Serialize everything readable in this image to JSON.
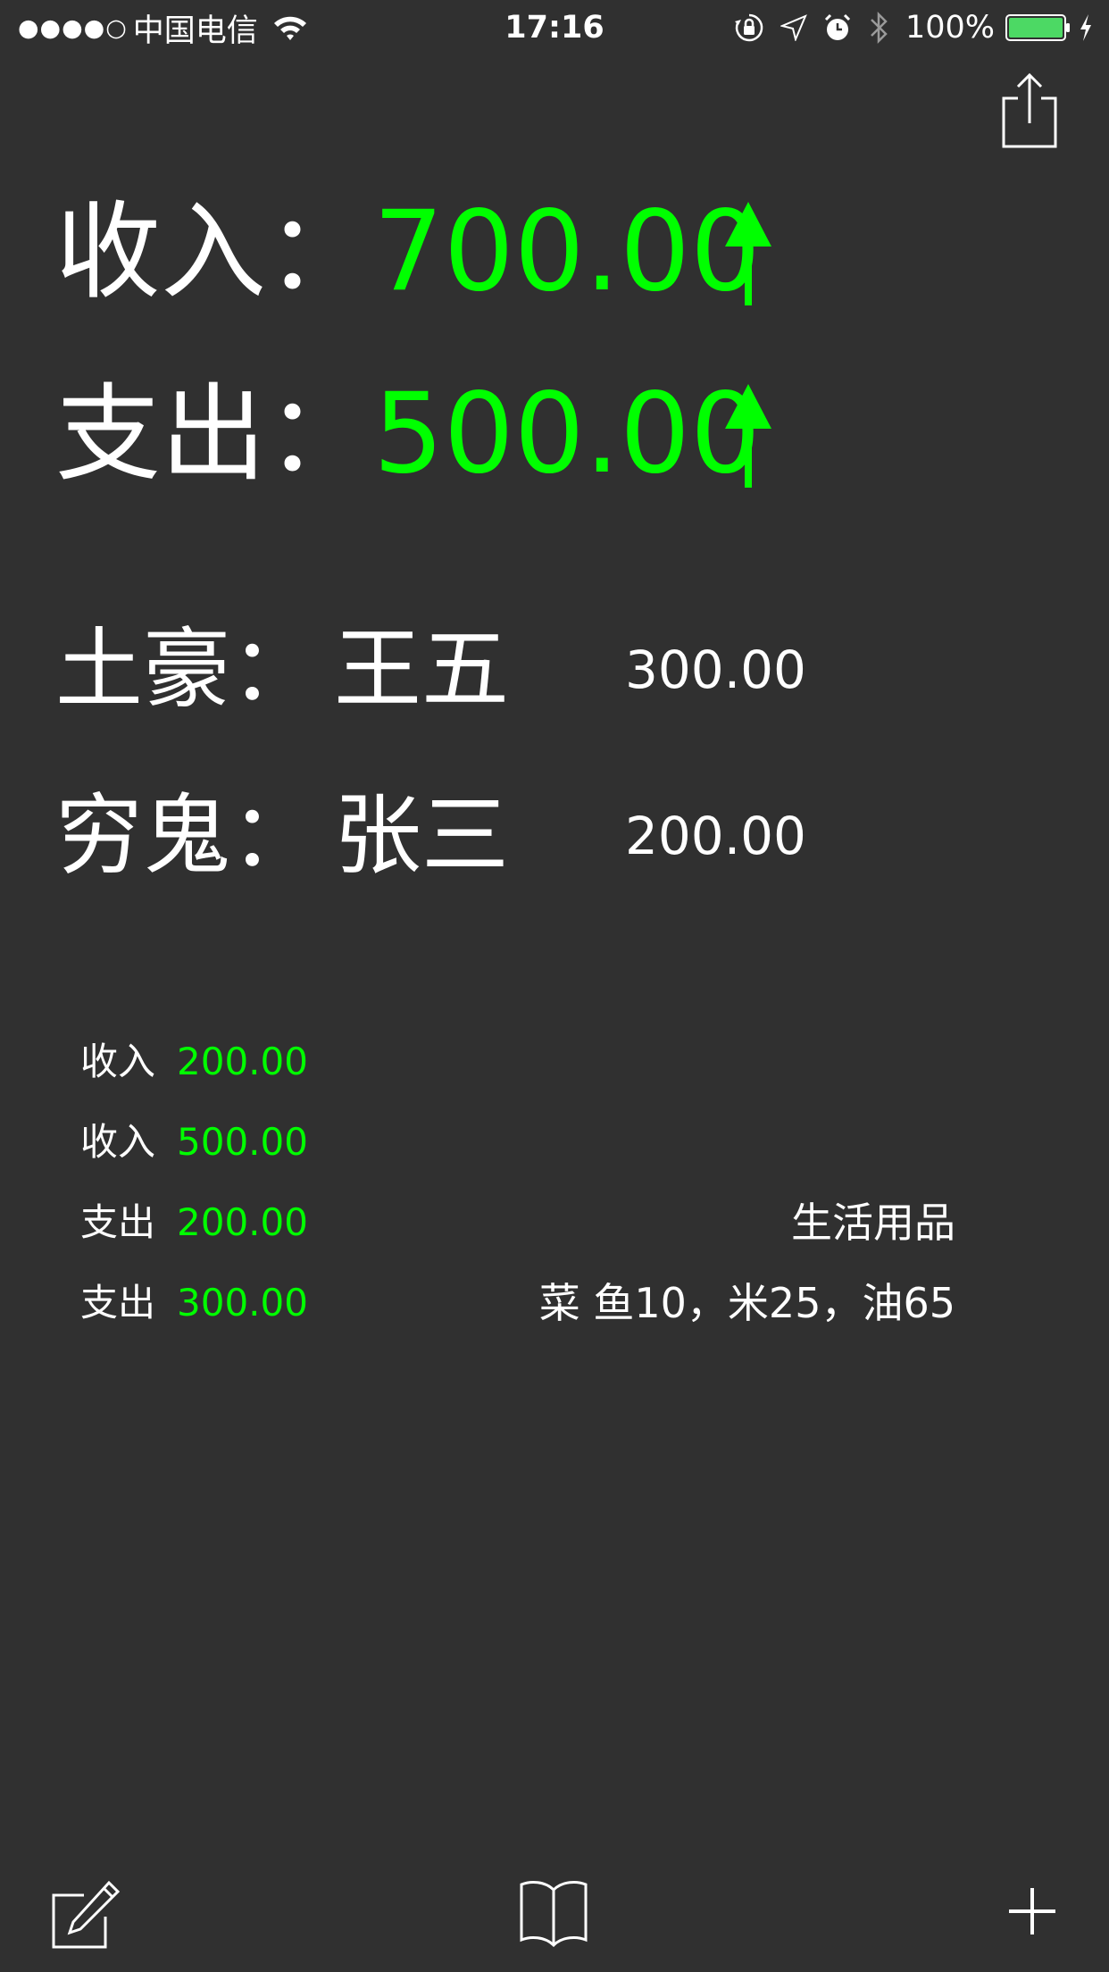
{
  "status_bar": {
    "signal": "●●●●○",
    "carrier": "中国电信",
    "time": "17:16",
    "battery_percent": "100%",
    "icons": [
      "wifi-icon",
      "orientation-lock-icon",
      "location-icon",
      "alarm-icon",
      "bluetooth-icon",
      "battery-icon",
      "charging-icon"
    ],
    "battery_level": 1.0,
    "battery_color": "#4cd964"
  },
  "header": {
    "share_icon": "share-icon"
  },
  "summary": {
    "income_label": "收入：",
    "income_value": "700.00",
    "expense_label": "支出：",
    "expense_value": "500.00",
    "trend_icon": "arrow-up-icon",
    "value_color": "#00ff00"
  },
  "people": {
    "rich_label": "土豪：",
    "rich_name": "王五",
    "rich_amount": "300.00",
    "poor_label": "穷鬼：",
    "poor_name": "张三",
    "poor_amount": "200.00"
  },
  "transactions": [
    {
      "type": "收入",
      "amount": "200.00",
      "note": ""
    },
    {
      "type": "收入",
      "amount": "500.00",
      "note": ""
    },
    {
      "type": "支出",
      "amount": "200.00",
      "note": "生活用品"
    },
    {
      "type": "支出",
      "amount": "300.00",
      "note": "菜 鱼10，米25，油65"
    }
  ],
  "toolbar": {
    "icons": [
      "compose-icon",
      "book-icon",
      "add-icon"
    ]
  }
}
